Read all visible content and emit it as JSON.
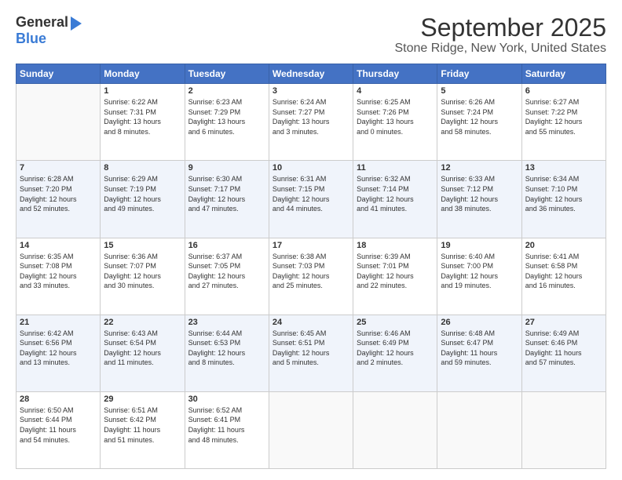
{
  "logo": {
    "general": "General",
    "blue": "Blue"
  },
  "title": "September 2025",
  "subtitle": "Stone Ridge, New York, United States",
  "weekdays": [
    "Sunday",
    "Monday",
    "Tuesday",
    "Wednesday",
    "Thursday",
    "Friday",
    "Saturday"
  ],
  "weeks": [
    [
      {
        "day": "",
        "info": ""
      },
      {
        "day": "1",
        "info": "Sunrise: 6:22 AM\nSunset: 7:31 PM\nDaylight: 13 hours\nand 8 minutes."
      },
      {
        "day": "2",
        "info": "Sunrise: 6:23 AM\nSunset: 7:29 PM\nDaylight: 13 hours\nand 6 minutes."
      },
      {
        "day": "3",
        "info": "Sunrise: 6:24 AM\nSunset: 7:27 PM\nDaylight: 13 hours\nand 3 minutes."
      },
      {
        "day": "4",
        "info": "Sunrise: 6:25 AM\nSunset: 7:26 PM\nDaylight: 13 hours\nand 0 minutes."
      },
      {
        "day": "5",
        "info": "Sunrise: 6:26 AM\nSunset: 7:24 PM\nDaylight: 12 hours\nand 58 minutes."
      },
      {
        "day": "6",
        "info": "Sunrise: 6:27 AM\nSunset: 7:22 PM\nDaylight: 12 hours\nand 55 minutes."
      }
    ],
    [
      {
        "day": "7",
        "info": "Sunrise: 6:28 AM\nSunset: 7:20 PM\nDaylight: 12 hours\nand 52 minutes."
      },
      {
        "day": "8",
        "info": "Sunrise: 6:29 AM\nSunset: 7:19 PM\nDaylight: 12 hours\nand 49 minutes."
      },
      {
        "day": "9",
        "info": "Sunrise: 6:30 AM\nSunset: 7:17 PM\nDaylight: 12 hours\nand 47 minutes."
      },
      {
        "day": "10",
        "info": "Sunrise: 6:31 AM\nSunset: 7:15 PM\nDaylight: 12 hours\nand 44 minutes."
      },
      {
        "day": "11",
        "info": "Sunrise: 6:32 AM\nSunset: 7:14 PM\nDaylight: 12 hours\nand 41 minutes."
      },
      {
        "day": "12",
        "info": "Sunrise: 6:33 AM\nSunset: 7:12 PM\nDaylight: 12 hours\nand 38 minutes."
      },
      {
        "day": "13",
        "info": "Sunrise: 6:34 AM\nSunset: 7:10 PM\nDaylight: 12 hours\nand 36 minutes."
      }
    ],
    [
      {
        "day": "14",
        "info": "Sunrise: 6:35 AM\nSunset: 7:08 PM\nDaylight: 12 hours\nand 33 minutes."
      },
      {
        "day": "15",
        "info": "Sunrise: 6:36 AM\nSunset: 7:07 PM\nDaylight: 12 hours\nand 30 minutes."
      },
      {
        "day": "16",
        "info": "Sunrise: 6:37 AM\nSunset: 7:05 PM\nDaylight: 12 hours\nand 27 minutes."
      },
      {
        "day": "17",
        "info": "Sunrise: 6:38 AM\nSunset: 7:03 PM\nDaylight: 12 hours\nand 25 minutes."
      },
      {
        "day": "18",
        "info": "Sunrise: 6:39 AM\nSunset: 7:01 PM\nDaylight: 12 hours\nand 22 minutes."
      },
      {
        "day": "19",
        "info": "Sunrise: 6:40 AM\nSunset: 7:00 PM\nDaylight: 12 hours\nand 19 minutes."
      },
      {
        "day": "20",
        "info": "Sunrise: 6:41 AM\nSunset: 6:58 PM\nDaylight: 12 hours\nand 16 minutes."
      }
    ],
    [
      {
        "day": "21",
        "info": "Sunrise: 6:42 AM\nSunset: 6:56 PM\nDaylight: 12 hours\nand 13 minutes."
      },
      {
        "day": "22",
        "info": "Sunrise: 6:43 AM\nSunset: 6:54 PM\nDaylight: 12 hours\nand 11 minutes."
      },
      {
        "day": "23",
        "info": "Sunrise: 6:44 AM\nSunset: 6:53 PM\nDaylight: 12 hours\nand 8 minutes."
      },
      {
        "day": "24",
        "info": "Sunrise: 6:45 AM\nSunset: 6:51 PM\nDaylight: 12 hours\nand 5 minutes."
      },
      {
        "day": "25",
        "info": "Sunrise: 6:46 AM\nSunset: 6:49 PM\nDaylight: 12 hours\nand 2 minutes."
      },
      {
        "day": "26",
        "info": "Sunrise: 6:48 AM\nSunset: 6:47 PM\nDaylight: 11 hours\nand 59 minutes."
      },
      {
        "day": "27",
        "info": "Sunrise: 6:49 AM\nSunset: 6:46 PM\nDaylight: 11 hours\nand 57 minutes."
      }
    ],
    [
      {
        "day": "28",
        "info": "Sunrise: 6:50 AM\nSunset: 6:44 PM\nDaylight: 11 hours\nand 54 minutes."
      },
      {
        "day": "29",
        "info": "Sunrise: 6:51 AM\nSunset: 6:42 PM\nDaylight: 11 hours\nand 51 minutes."
      },
      {
        "day": "30",
        "info": "Sunrise: 6:52 AM\nSunset: 6:41 PM\nDaylight: 11 hours\nand 48 minutes."
      },
      {
        "day": "",
        "info": ""
      },
      {
        "day": "",
        "info": ""
      },
      {
        "day": "",
        "info": ""
      },
      {
        "day": "",
        "info": ""
      }
    ]
  ]
}
